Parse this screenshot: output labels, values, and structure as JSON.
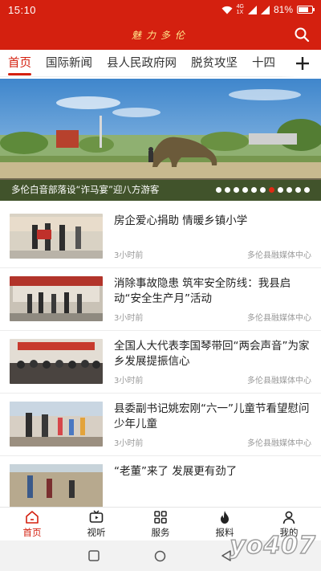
{
  "status_bar": {
    "time": "15:10",
    "network_top": "4G",
    "network_bottom": "1X",
    "battery_percent": "81%",
    "battery_level": 0.81
  },
  "header": {
    "logo_text": "魅力多伦"
  },
  "tabs": [
    {
      "label": "首页",
      "active": true
    },
    {
      "label": "国际新闻",
      "active": false
    },
    {
      "label": "县人民政府网",
      "active": false
    },
    {
      "label": "脱贫攻坚",
      "active": false
    },
    {
      "label": "十四",
      "active": false
    }
  ],
  "banner": {
    "caption": "多伦白音部落设“诈马宴”迎八方游客",
    "dot_count": 11,
    "active_dot": 6
  },
  "news": [
    {
      "title": "房企爱心捐助  情暖乡镇小学",
      "time": "3小时前",
      "source": "多伦县融媒体中心"
    },
    {
      "title": "消除事故隐患 筑牢安全防线：我县启动“安全生产月”活动",
      "time": "3小时前",
      "source": "多伦县融媒体中心"
    },
    {
      "title": "全国人大代表李国琴带回“两会声音”为家乡发展提振信心",
      "time": "3小时前",
      "source": "多伦县融媒体中心"
    },
    {
      "title": "县委副书记姚宏刚“六一”儿童节看望慰问少年儿童",
      "time": "3小时前",
      "source": "多伦县融媒体中心"
    },
    {
      "title": "“老董”来了 发展更有劲了",
      "time": "",
      "source": ""
    }
  ],
  "bottom_nav": [
    {
      "label": "首页",
      "icon": "home-icon",
      "active": true
    },
    {
      "label": "视听",
      "icon": "tv-icon",
      "active": false
    },
    {
      "label": "服务",
      "icon": "grid-icon",
      "active": false
    },
    {
      "label": "报料",
      "icon": "flame-icon",
      "active": false
    },
    {
      "label": "我的",
      "icon": "person-icon",
      "active": false
    }
  ],
  "watermark": "yo407",
  "colors": {
    "brand_red": "#d4200f",
    "logo_gold": "#ffe58a",
    "meta_gray": "#999999"
  }
}
